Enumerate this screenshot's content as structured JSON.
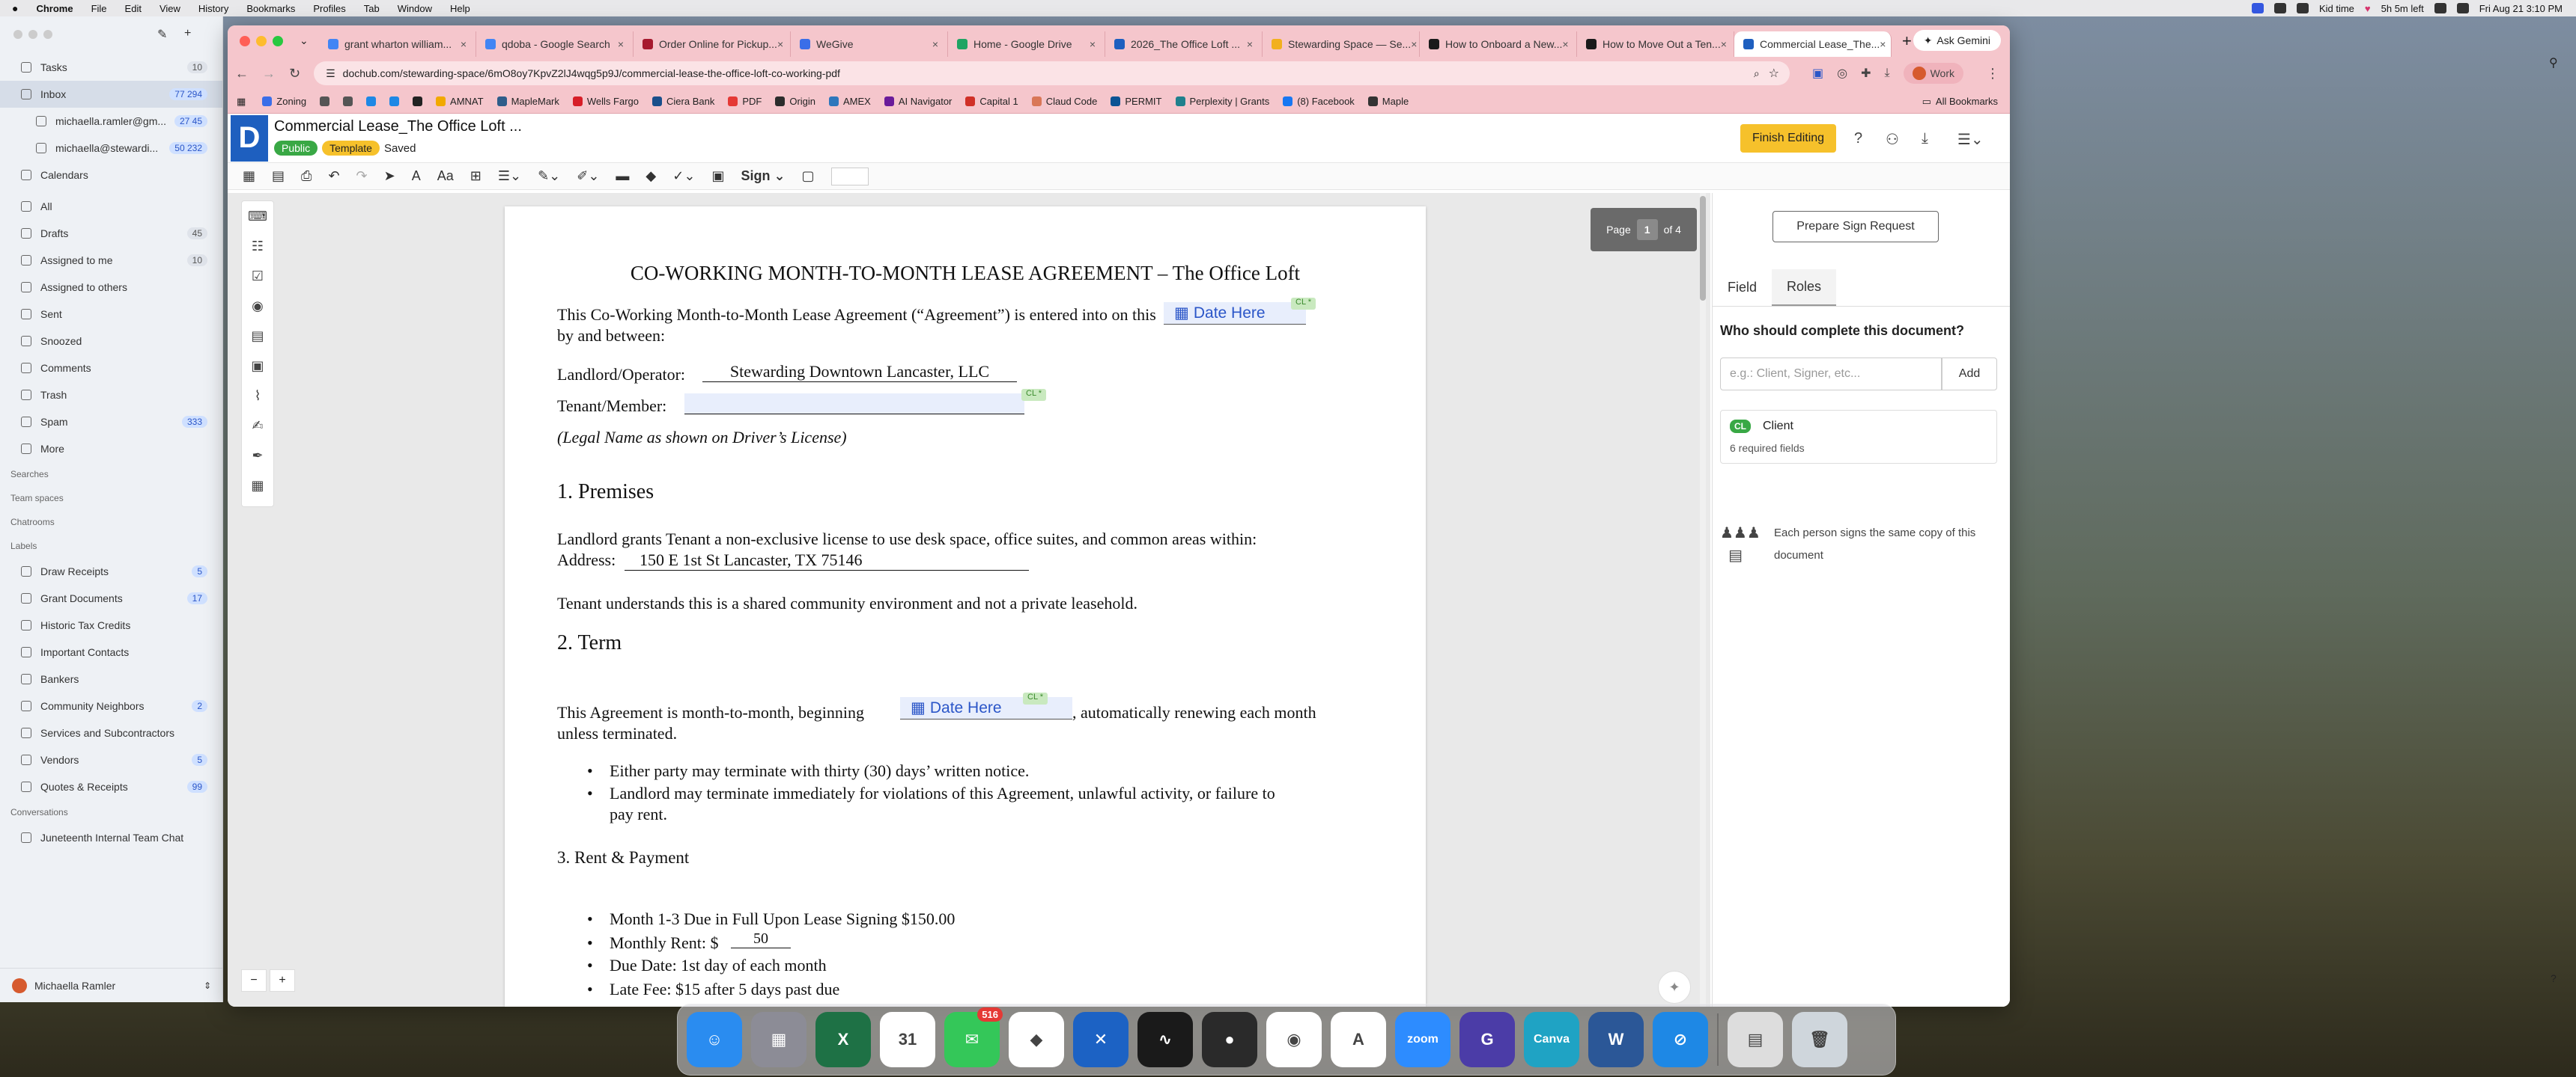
{
  "menubar": {
    "app": "Chrome",
    "items": [
      "File",
      "Edit",
      "View",
      "History",
      "Bookmarks",
      "Profiles",
      "Tab",
      "Window",
      "Help"
    ],
    "kid_time": "Kid time",
    "time_left": "5h 5m left",
    "datetime": "Fri Aug 21  3:10 PM"
  },
  "mail": {
    "top_items": [
      {
        "label": "Tasks",
        "count": "10"
      },
      {
        "label": "Inbox",
        "count": "77  294"
      },
      {
        "label": "michaella.ramler@gm...",
        "count": "27  45"
      },
      {
        "label": "michaella@stewardi...",
        "count": "50  232"
      },
      {
        "label": "Calendars",
        "count": ""
      }
    ],
    "folders": [
      {
        "label": "All",
        "count": ""
      },
      {
        "label": "Drafts",
        "count": "45"
      },
      {
        "label": "Assigned to me",
        "count": "10"
      },
      {
        "label": "Assigned to others",
        "count": ""
      },
      {
        "label": "Sent",
        "count": ""
      },
      {
        "label": "Snoozed",
        "count": ""
      },
      {
        "label": "Comments",
        "count": ""
      },
      {
        "label": "Trash",
        "count": ""
      },
      {
        "label": "Spam",
        "count": "333"
      },
      {
        "label": "More",
        "count": ""
      }
    ],
    "sections": {
      "searches": "Searches",
      "team_spaces": "Team spaces",
      "chatrooms": "Chatrooms",
      "labels": "Labels",
      "conversations": "Conversations"
    },
    "labels": [
      {
        "label": "Draw Receipts",
        "count": "5"
      },
      {
        "label": "Grant Documents",
        "count": "17"
      },
      {
        "label": "Historic Tax Credits",
        "count": ""
      },
      {
        "label": "Important Contacts",
        "count": ""
      },
      {
        "label": "Bankers",
        "count": ""
      },
      {
        "label": "Community Neighbors",
        "count": "2"
      },
      {
        "label": "Services and Subcontractors",
        "count": ""
      },
      {
        "label": "Vendors",
        "count": "5"
      },
      {
        "label": "Quotes & Receipts",
        "count": "99"
      }
    ],
    "conversations": [
      {
        "label": "Juneteenth Internal Team Chat"
      }
    ],
    "user": "Michaella Ramler"
  },
  "chrome": {
    "tabs": [
      {
        "title": "grant wharton william...",
        "color": "#4285f4"
      },
      {
        "title": "qdoba - Google Search",
        "color": "#4285f4"
      },
      {
        "title": "Order Online for Pickup...",
        "color": "#a6192e"
      },
      {
        "title": "WeGive",
        "color": "#3a6ee8"
      },
      {
        "title": "Home - Google Drive",
        "color": "#1fa463"
      },
      {
        "title": "2026_The Office Loft ...",
        "color": "#1e5fbf"
      },
      {
        "title": "Stewarding Space — Se...",
        "color": "#f2b01e"
      },
      {
        "title": "How to Onboard a New...",
        "color": "#1a1a1a"
      },
      {
        "title": "How to Move Out a Ten...",
        "color": "#1a1a1a"
      },
      {
        "title": "Commercial Lease_The...",
        "color": "#1e5fbf"
      }
    ],
    "ask_gemini": "Ask Gemini",
    "url": "dochub.com/stewarding-space/6mO8oy7KpvZ2lJ4wqg5p9J/commercial-lease-the-office-loft-co-working-pdf",
    "profile": "Work",
    "bookmarks": [
      {
        "label": "Zoning",
        "color": "#3a6ee8"
      },
      {
        "label": "",
        "color": "#555555"
      },
      {
        "label": "",
        "color": "#555555"
      },
      {
        "label": "",
        "color": "#1e88e5"
      },
      {
        "label": "",
        "color": "#1e88e5"
      },
      {
        "label": "",
        "color": "#222222"
      },
      {
        "label": "AMNAT",
        "color": "#f2a900"
      },
      {
        "label": "MapleMark",
        "color": "#2f5d8a"
      },
      {
        "label": "Wells Fargo",
        "color": "#d71e28"
      },
      {
        "label": "Ciera Bank",
        "color": "#1a4f8b"
      },
      {
        "label": "PDF",
        "color": "#e53935"
      },
      {
        "label": "Origin",
        "color": "#2c2c2c"
      },
      {
        "label": "AMEX",
        "color": "#2e77bc"
      },
      {
        "label": "AI Navigator",
        "color": "#6a1b9a"
      },
      {
        "label": "Capital 1",
        "color": "#d03027"
      },
      {
        "label": "Claud Code",
        "color": "#d97757"
      },
      {
        "label": "PERMIT",
        "color": "#0b5394"
      },
      {
        "label": "Perplexity | Grants",
        "color": "#20808d"
      },
      {
        "label": "(8) Facebook",
        "color": "#1877f2"
      },
      {
        "label": "Maple",
        "color": "#333333"
      }
    ],
    "all_bookmarks": "All Bookmarks"
  },
  "app": {
    "logo": "D",
    "doc_title": "Commercial Lease_The Office Loft ...",
    "badge_public": "Public",
    "badge_template": "Template",
    "status": "Saved",
    "finish_button": "Finish Editing",
    "sign_label": "Sign"
  },
  "document": {
    "title": "CO-WORKING MONTH-TO-MONTH LEASE AGREEMENT – The Office Loft",
    "intro_1": "This Co-Working Month-to-Month Lease Agreement (“Agreement”) is entered into on this",
    "intro_2": "by and between:",
    "date_placeholder": "Date Here",
    "role_tag": "CL *",
    "landlord_label": "Landlord/Operator:",
    "landlord_value": "Stewarding Downtown Lancaster, LLC",
    "tenant_label": "Tenant/Member:",
    "legal_note": "(Legal Name as shown on Driver’s License)",
    "premises_heading": "1. Premises",
    "premises_text": "Landlord grants Tenant a non-exclusive license to use desk space, office suites, and common areas within:",
    "address_label": "Address:",
    "address_value": "150 E 1st St Lancaster, TX 75146",
    "shared_text": "Tenant understands this is a shared community environment and not a private leasehold.",
    "term_heading": "2. Term",
    "term_text_1": "This Agreement is month-to-month, beginning",
    "term_text_2": ", automatically renewing each month",
    "term_text_3": "unless terminated.",
    "term_bullets": [
      "Either party may terminate with thirty (30) days’ written notice.",
      "Landlord may terminate immediately for violations of this Agreement, unlawful activity, or failure to",
      "pay rent."
    ],
    "rent_heading": "3. Rent & Payment",
    "rent_bullets": [
      "Month 1-3 Due in Full Upon Lease Signing $150.00",
      "Monthly Rent: $",
      "Due Date: 1st day of each month",
      "Late Fee: $15 after 5 days past due"
    ],
    "monthly_rent_value": "50"
  },
  "page_nav": {
    "label": "Page",
    "current": "1",
    "of": "of 4"
  },
  "right_panel": {
    "prepare_button": "Prepare Sign Request",
    "tab_field": "Field",
    "tab_roles": "Roles",
    "question": "Who should complete this document?",
    "role_placeholder": "e.g.: Client, Signer, etc...",
    "add_button": "Add",
    "role_tag": "CL",
    "role_name": "Client",
    "role_required": "6 required fields",
    "sign_info": "Each person signs the same copy of this document"
  },
  "dock": {
    "apps": [
      {
        "name": "finder",
        "color": "#2a8cf0",
        "glyph": "☺"
      },
      {
        "name": "launchpad",
        "color": "#8c8c96",
        "glyph": "▦"
      },
      {
        "name": "excel",
        "color": "#1e7145",
        "glyph": "X"
      },
      {
        "name": "calendar",
        "color": "#ffffff",
        "glyph": "31"
      },
      {
        "name": "messages",
        "color": "#34c759",
        "glyph": "✉",
        "badge": "516"
      },
      {
        "name": "clickup",
        "color": "#ffffff",
        "glyph": "◆"
      },
      {
        "name": "xcode",
        "color": "#1c62c4",
        "glyph": "✕"
      },
      {
        "name": "voice-memos",
        "color": "#1a1a1a",
        "glyph": "∿"
      },
      {
        "name": "android-messages",
        "color": "#2a2a2a",
        "glyph": "●"
      },
      {
        "name": "chrome",
        "color": "#ffffff",
        "glyph": "◉"
      },
      {
        "name": "arc",
        "color": "#ffffff",
        "glyph": "A"
      },
      {
        "name": "zoom",
        "color": "#2d8cff",
        "glyph": "zoom"
      },
      {
        "name": "grammarly",
        "color": "#4b3ca7",
        "glyph": "G"
      },
      {
        "name": "canva",
        "color": "#1fa3c4",
        "glyph": "Canva"
      },
      {
        "name": "word",
        "color": "#2b5797",
        "glyph": "W"
      },
      {
        "name": "safari",
        "color": "#1e88e5",
        "glyph": "⊘"
      }
    ],
    "right_apps": [
      {
        "name": "documents",
        "color": "#dddddd",
        "glyph": "▤"
      },
      {
        "name": "trash",
        "color": "#cfd6dc",
        "glyph": "🗑"
      }
    ]
  }
}
